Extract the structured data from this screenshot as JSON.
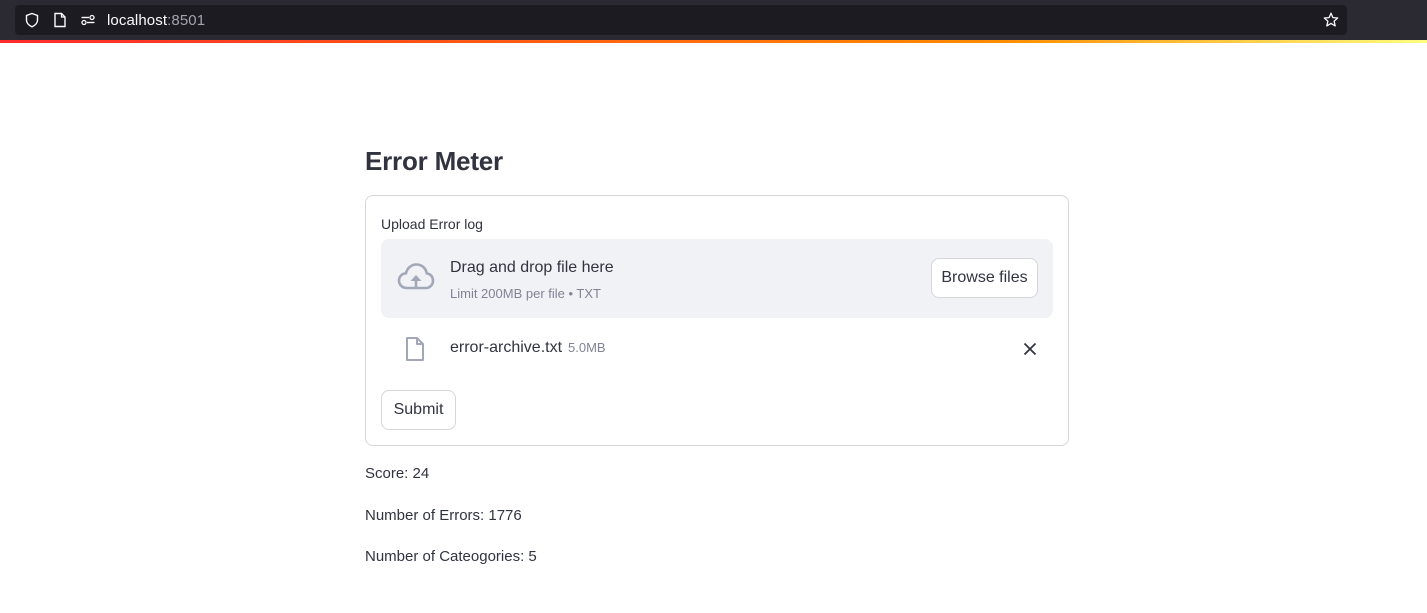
{
  "browser": {
    "url_host": "localhost",
    "url_port": ":8501",
    "icons": [
      "shield-icon",
      "page-icon",
      "permissions-icon",
      "star-icon"
    ]
  },
  "app": {
    "title": "Error Meter",
    "uploader": {
      "label": "Upload Error log",
      "drop_title": "Drag and drop file here",
      "drop_subtitle": "Limit 200MB per file • TXT",
      "browse_label": "Browse files",
      "file": {
        "name": "error-archive.txt",
        "size": "5.0MB"
      }
    },
    "submit_label": "Submit",
    "results": {
      "score": "Score: 24",
      "errors": "Number of Errors: 1776",
      "categories": "Number of Cateogories: 5"
    }
  },
  "colors": {
    "text": "#31333f",
    "muted": "#808495",
    "dropzone_bg": "#f0f2f6",
    "border": "#d6d6d9",
    "chrome_bg": "#2b2a33",
    "accent_red": "#ff2b2b"
  }
}
